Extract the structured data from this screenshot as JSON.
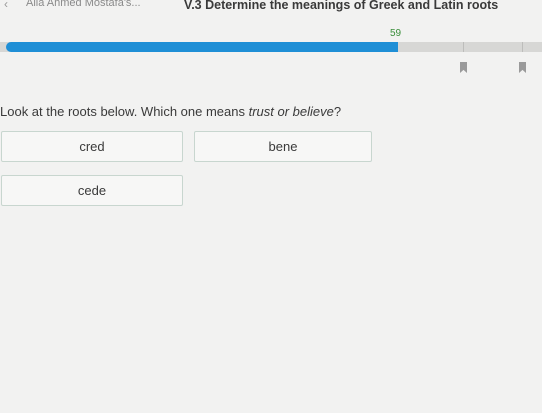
{
  "header": {
    "breadcrumb": "Alia Ahmed Mostafa's...",
    "title": "V.3 Determine the meanings of Greek and Latin roots",
    "back_icon": "chevron-left-icon"
  },
  "progress": {
    "score_label": "59",
    "fill_fraction": 0.73,
    "milestone_icons": [
      "bookmark-icon",
      "bookmark-icon"
    ]
  },
  "question": {
    "prefix": "Look at the roots below. Which one means ",
    "emphasis": "trust or believe",
    "suffix": "?"
  },
  "choices": [
    {
      "label": "cred"
    },
    {
      "label": "bene"
    },
    {
      "label": "cede"
    }
  ],
  "colors": {
    "progress": "#1f8fd6",
    "score": "#3b8f3b",
    "background": "#f2f2f1"
  }
}
